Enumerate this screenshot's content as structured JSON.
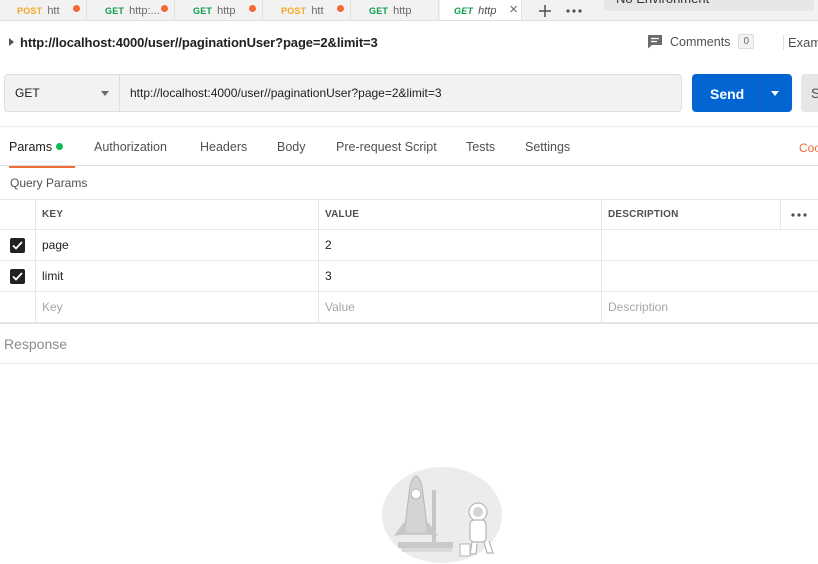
{
  "tabs": [
    {
      "method": "POST",
      "url": "htt",
      "method_color": "#f6a623",
      "dirty": true
    },
    {
      "method": "GET",
      "url": "http:...",
      "method_color": "#0b9c49",
      "dirty": true
    },
    {
      "method": "GET",
      "url": "http",
      "method_color": "#0b9c49",
      "dirty": true
    },
    {
      "method": "POST",
      "url": "htt",
      "method_color": "#f6a623",
      "dirty": true
    },
    {
      "method": "GET",
      "url": "http",
      "method_color": "#0b9c49",
      "dirty": false
    },
    {
      "method": "GET",
      "url": "http",
      "method_color": "#0b9c49",
      "dirty": false,
      "active": true
    }
  ],
  "environment": {
    "label": "No Environment"
  },
  "request": {
    "title": "http://localhost:4000/user//paginationUser?page=2&limit=3",
    "method": "GET",
    "url": "http://localhost:4000/user//paginationUser?page=2&limit=3",
    "send_label": "Send",
    "save_label": "S"
  },
  "header_actions": {
    "comments_label": "Comments",
    "comments_count": "0",
    "examples_label": "Exam"
  },
  "request_tabs": [
    {
      "label": "Params",
      "active": true
    },
    {
      "label": "Authorization"
    },
    {
      "label": "Headers"
    },
    {
      "label": "Body"
    },
    {
      "label": "Pre-request Script"
    },
    {
      "label": "Tests"
    },
    {
      "label": "Settings"
    }
  ],
  "cookies_label": "Coo",
  "query_params": {
    "title": "Query Params",
    "columns": {
      "key": "KEY",
      "value": "VALUE",
      "description": "DESCRIPTION"
    },
    "rows": [
      {
        "key": "page",
        "value": "2",
        "checked": true
      },
      {
        "key": "limit",
        "value": "3",
        "checked": true
      }
    ],
    "placeholders": {
      "key": "Key",
      "value": "Value",
      "description": "Description"
    }
  },
  "response": {
    "label": "Response"
  },
  "colors": {
    "accent": "#f26b3a",
    "send": "#0265d2",
    "get": "#0b9c49",
    "post": "#f6a623"
  }
}
